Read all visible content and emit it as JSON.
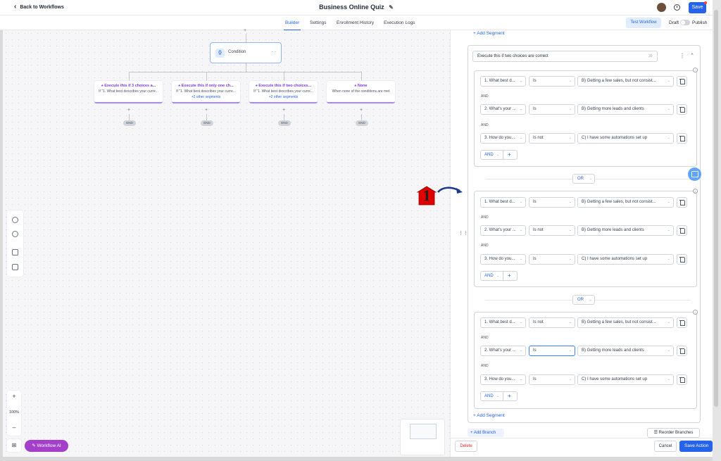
{
  "header": {
    "back_label": "Back to Workflows",
    "title": "Business Online Quiz",
    "save_label": "Save"
  },
  "tabs": [
    "Builder",
    "Settings",
    "Enrollment History",
    "Execution Logs"
  ],
  "active_tab": "Builder",
  "toolbar": {
    "test_label": "Test Workflow",
    "draft_label": "Draft",
    "publish_label": "Publish"
  },
  "canvas": {
    "condition_label": "Condition",
    "condition_icon": "{}",
    "branches": [
      {
        "title": "Execute this if 3 choices a...",
        "subtitle": "If \"1. What best describes your curre...",
        "other": ""
      },
      {
        "title": "Execute this if only one ch...",
        "subtitle": "If \"1. What best describes your curre...",
        "other": "+2 other segments"
      },
      {
        "title": "Execute this if two choices...",
        "subtitle": "If \"1. What best describes your curre...",
        "other": "+2 other segments"
      },
      {
        "title": "None",
        "subtitle": "When none of the conditions are met",
        "other": ""
      }
    ],
    "end_label": "END",
    "zoom_level": "100%",
    "ai_label": "Workflow AI"
  },
  "panel": {
    "add_segment_label": "+ Add Segment",
    "branch_name": "Execute this if two choices are correct",
    "branch_name_count": "39",
    "and_label": "AND",
    "or_label": "OR",
    "segments": [
      {
        "rows": [
          {
            "field": "1. What best d...",
            "op": "Is",
            "value": "B) Getting a few sales, but not consist..."
          },
          {
            "field": "2. What's your ...",
            "op": "Is",
            "value": "B) Getting more leads and clients"
          },
          {
            "field": "3. How do you...",
            "op": "Is not",
            "value": "C) I have some automations set up"
          }
        ]
      },
      {
        "rows": [
          {
            "field": "1. What best d...",
            "op": "Is",
            "value": "B) Getting a few sales, but not consist..."
          },
          {
            "field": "2. What's your ...",
            "op": "Is not",
            "value": "B) Getting more leads and clients"
          },
          {
            "field": "3. How do you...",
            "op": "Is",
            "value": "C) I have some automations set up"
          }
        ]
      },
      {
        "rows": [
          {
            "field": "1. What best d...",
            "op": "Is not",
            "value": "B) Getting a few sales, but not consist..."
          },
          {
            "field": "2. What's your ...",
            "op": "Is",
            "value": "B) Getting more leads and clients"
          },
          {
            "field": "3. How do you...",
            "op": "Is",
            "value": "C) I have some automations set up"
          }
        ]
      }
    ],
    "add_branch_label": "+ Add Branch",
    "reorder_label": "Reorder Branches",
    "delete_label": "Delete",
    "cancel_label": "Cancel",
    "save_action_label": "Save Action"
  },
  "annotation": {
    "number": "1",
    "color": "#e00000",
    "arrow_color": "#1e3a8a"
  }
}
